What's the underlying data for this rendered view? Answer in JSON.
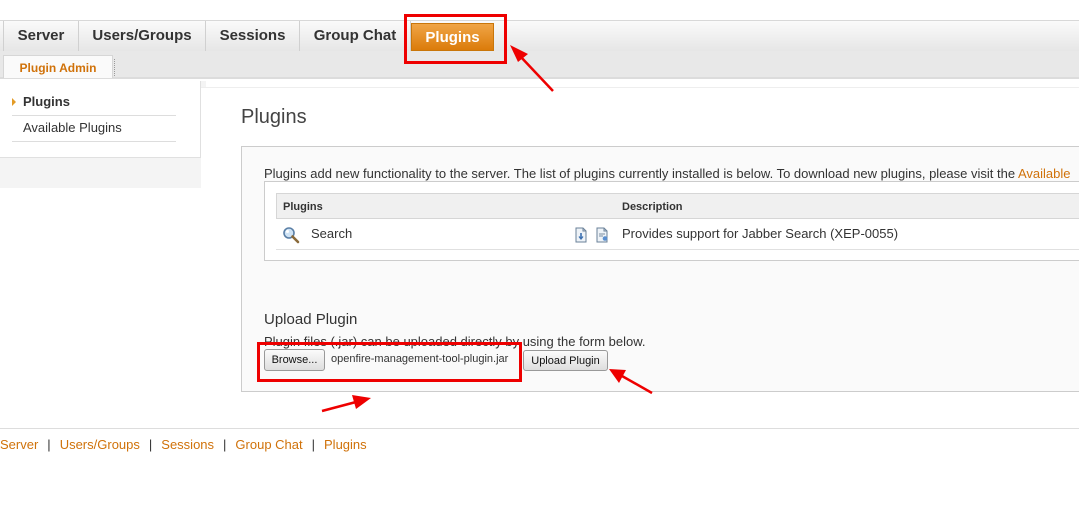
{
  "main_tabs": [
    "Server",
    "Users/Groups",
    "Sessions",
    "Group Chat",
    "Plugins"
  ],
  "sub_tabs": [
    "Plugin Admin"
  ],
  "sidebar": {
    "items": [
      {
        "label": "Plugins",
        "selected": true
      },
      {
        "label": "Available Plugins",
        "selected": false
      }
    ]
  },
  "page": {
    "title": "Plugins",
    "intro_text": "Plugins add new functionality to the server. The list of plugins currently installed is below. To download new plugins, please visit the",
    "intro_link": "Available"
  },
  "plugin_table": {
    "headers": {
      "plugins": "Plugins",
      "description": "Description"
    },
    "rows": [
      {
        "name": "Search",
        "description": "Provides support for Jabber Search (XEP-0055)",
        "icon": "search-icon"
      }
    ]
  },
  "upload": {
    "title": "Upload Plugin",
    "text": "Plugin files (.jar) can be uploaded directly by using the form below.",
    "browse_label": "Browse...",
    "file_name": "openfire-management-tool-plugin.jar",
    "upload_label": "Upload Plugin"
  },
  "footer": {
    "links": [
      "Server",
      "Users/Groups",
      "Sessions",
      "Group Chat",
      "Plugins"
    ]
  },
  "colors": {
    "accent": "#db7b0a",
    "link": "#d0720a",
    "annotation": "#ee0000"
  }
}
